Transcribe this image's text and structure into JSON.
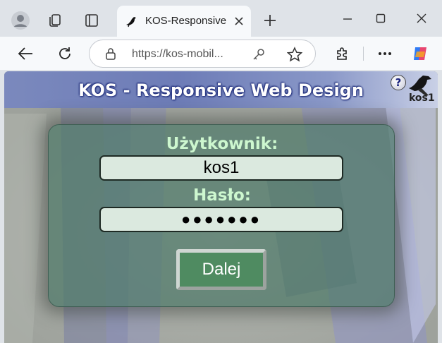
{
  "browser": {
    "tab_title": "KOS-Responsive W",
    "url": "https://kos-mobil...",
    "icons": [
      "profile-icon",
      "collections-icon",
      "tab-actions-icon",
      "crow-icon",
      "close-icon",
      "new-tab-icon",
      "back-icon",
      "refresh-icon",
      "lock-icon",
      "key-icon",
      "star-icon",
      "extensions-icon",
      "more-icon",
      "copilot-icon"
    ],
    "window_controls": [
      "minimize",
      "maximize",
      "close"
    ]
  },
  "page": {
    "banner_title": "KOS - Responsive Web Design",
    "help_label": "?",
    "user_badge": "kos1",
    "login": {
      "username_label": "Użytkownik:",
      "username_value": "kos1",
      "password_label": "Hasło:",
      "password_value": "●●●●●●●",
      "submit_label": "Dalej"
    }
  },
  "colors": {
    "banner": "#6d7cb7",
    "panel": "#4e7868",
    "label": "#cdf7cf",
    "button": "#4f8b61",
    "field": "#dbe9df"
  }
}
